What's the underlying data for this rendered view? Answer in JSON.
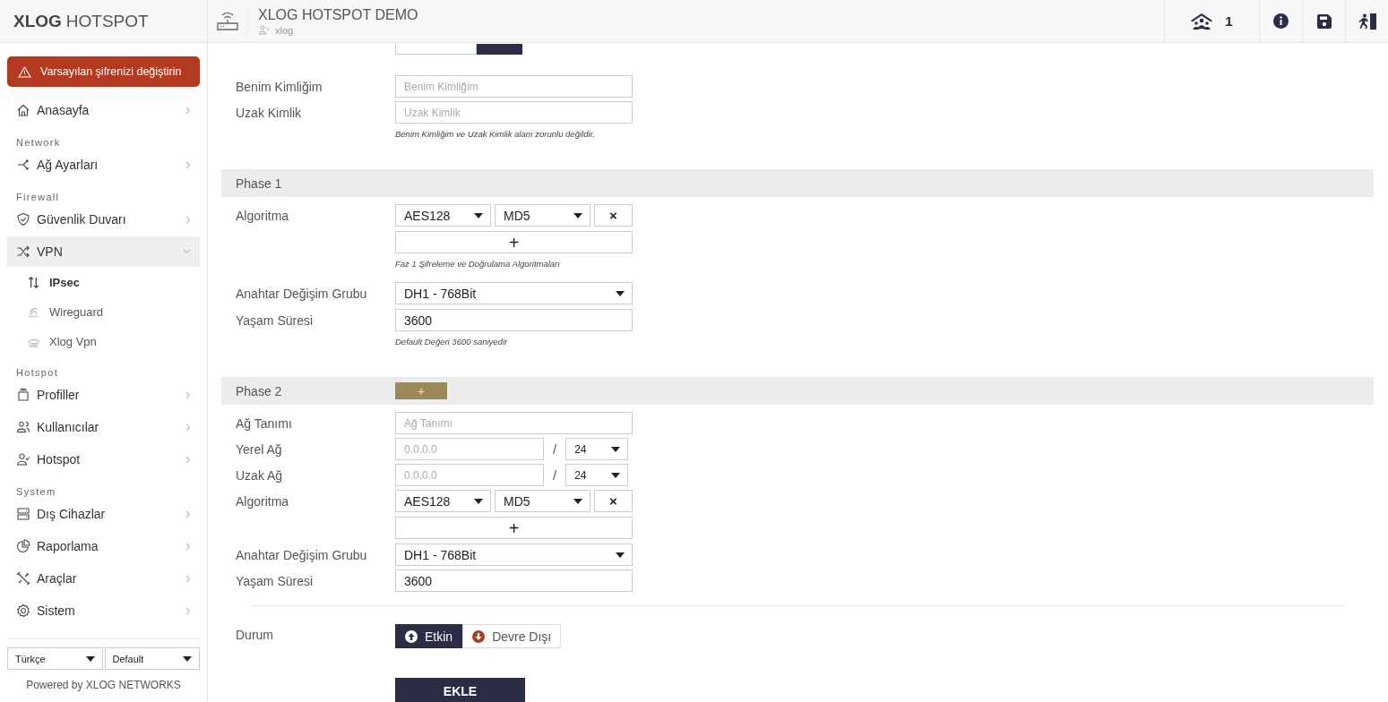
{
  "brand": {
    "strong": "XLOG",
    "light": "HOTSPOT"
  },
  "header": {
    "title": "XLOG HOTSPOT DEMO",
    "user": "xlog",
    "online_count": "1"
  },
  "sidebar": {
    "alert": "Varsayılan şifrenizi değiştirin",
    "items": [
      {
        "kind": "item",
        "label": "Anasayfa",
        "expanded": false
      },
      {
        "kind": "section",
        "label": "Network"
      },
      {
        "kind": "item",
        "label": "Ağ Ayarları",
        "expanded": false
      },
      {
        "kind": "section",
        "label": "Firewall"
      },
      {
        "kind": "item",
        "label": "Güvenlik Duvarı",
        "expanded": false
      },
      {
        "kind": "item",
        "label": "VPN",
        "expanded": true,
        "children": [
          {
            "label": "IPsec",
            "selected": true
          },
          {
            "label": "Wireguard",
            "selected": false
          },
          {
            "label": "Xlog Vpn",
            "selected": false
          }
        ]
      },
      {
        "kind": "section",
        "label": "Hotspot"
      },
      {
        "kind": "item",
        "label": "Profiller",
        "expanded": false
      },
      {
        "kind": "item",
        "label": "Kullanıcılar",
        "expanded": false
      },
      {
        "kind": "item",
        "label": "Hotspot",
        "expanded": false
      },
      {
        "kind": "section",
        "label": "System"
      },
      {
        "kind": "item",
        "label": "Dış Cihazlar",
        "expanded": false
      },
      {
        "kind": "item",
        "label": "Raporlama",
        "expanded": false
      },
      {
        "kind": "item",
        "label": "Araçlar",
        "expanded": false
      },
      {
        "kind": "item",
        "label": "Sistem",
        "expanded": false
      }
    ],
    "language": "Türkçe",
    "theme": "Default",
    "footer": "Powered by XLOG NETWORKS"
  },
  "form": {
    "ike_mode": {
      "options": [
        {
          "selected": false
        },
        {
          "selected": true
        }
      ]
    },
    "my_id": {
      "label": "Benim Kimliğim",
      "placeholder": "Benim Kimliğim"
    },
    "remote_id": {
      "label": "Uzak Kimlik",
      "placeholder": "Uzak Kimlik"
    },
    "id_help": "Benim Kimliğim ve Uzak Kimlik alanı zorunlu değildir.",
    "phase1": {
      "title": "Phase 1",
      "algorithm_label": "Algoritma",
      "algorithms": [
        {
          "cipher": "AES128",
          "hash": "MD5",
          "remove": "×"
        }
      ],
      "add": "+",
      "algorithm_help": "Faz 1 Şifreleme ve Doğrulama Algoritmaları",
      "dh_label": "Anahtar Değişim Grubu",
      "dh_group": "DH1 - 768Bit",
      "lifetime_label": "Yaşam Süresi",
      "lifetime": "3600",
      "lifetime_help": "Default Değeri 3600 saniyedir"
    },
    "phase2": {
      "title": "Phase 2",
      "add_button": "+",
      "name": {
        "label": "Ağ Tanımı",
        "placeholder": "Ağ Tanımı"
      },
      "networks": [
        {
          "label": "Yerel Ağ",
          "placeholder": "0.0.0.0",
          "separator": "/",
          "prefix": "24"
        },
        {
          "label": "Uzak Ağ",
          "placeholder": "0.0.0.0",
          "separator": "/",
          "prefix": "24"
        }
      ],
      "algorithm_label": "Algoritma",
      "algorithms": [
        {
          "cipher": "AES128",
          "hash": "MD5",
          "remove": "×"
        }
      ],
      "add": "+",
      "dh_label": "Anahtar Değişim Grubu",
      "dh_group": "DH1 - 768Bit",
      "lifetime_label": "Yaşam Süresi",
      "lifetime": "3600"
    },
    "status": {
      "label": "Durum",
      "options": [
        {
          "label": "Etkin",
          "selected": true
        },
        {
          "label": "Devre Dışı",
          "selected": false
        }
      ]
    },
    "submit": "EKLE"
  }
}
